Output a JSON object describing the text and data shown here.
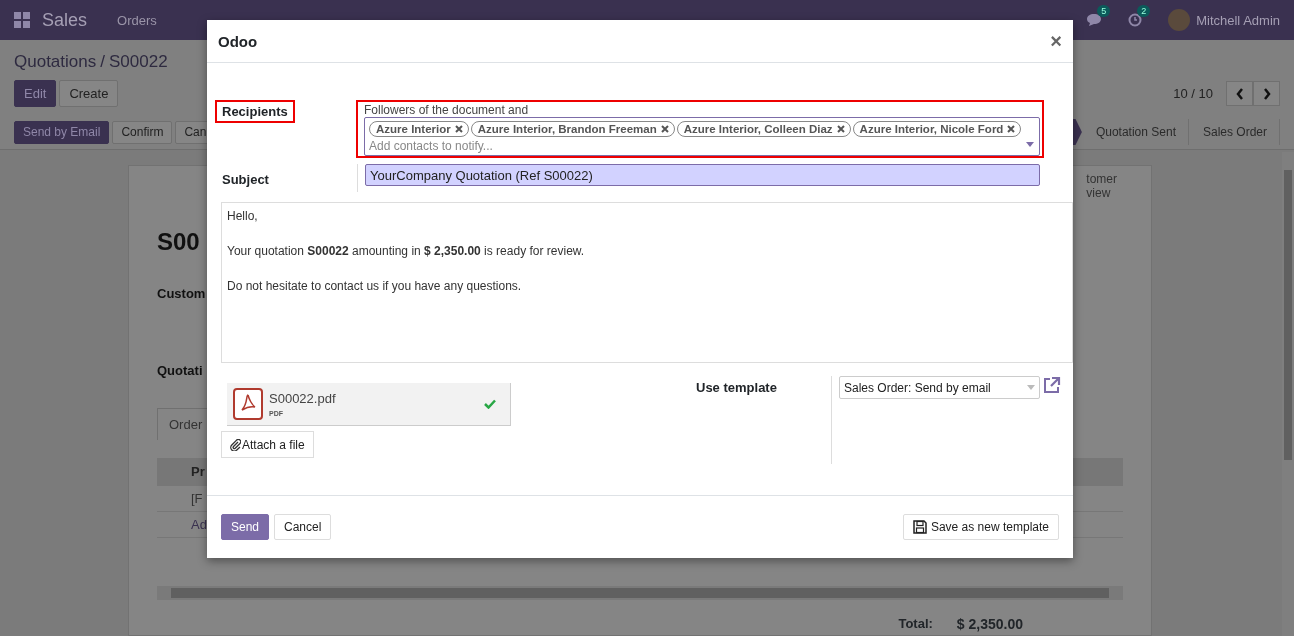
{
  "navbar": {
    "app": "Sales",
    "menu": [
      "Orders"
    ],
    "messages_badge": "5",
    "activities_badge": "2",
    "user": "Mitchell Admin"
  },
  "breadcrumb": {
    "parent": "Quotations",
    "separator": "/",
    "current": "S00022"
  },
  "actions": [
    "Edit",
    "Create"
  ],
  "pager": "10 / 10",
  "status_buttons": [
    {
      "label": "Send by Email",
      "primary": true
    },
    {
      "label": "Confirm",
      "primary": false
    },
    {
      "label": "Can",
      "primary": false
    }
  ],
  "stages": [
    "Quotation Sent",
    "Sales Order"
  ],
  "sheet": {
    "title": "S00",
    "field_labels": [
      "Custom",
      "Quotati"
    ],
    "smart_button": [
      "tomer",
      "view"
    ],
    "tab": "Order",
    "table_header": "Pr",
    "rows": [
      "[F",
      "Ad"
    ],
    "total_label": "Total:",
    "total_value": "$ 2,350.00"
  },
  "dialog": {
    "title": "Odoo",
    "close": "×",
    "recipients_label": "Recipients",
    "recipients_highlighted": true,
    "recipients_hint": "Followers of the document and",
    "recipients": [
      "Azure Interior",
      "Azure Interior, Brandon Freeman",
      "Azure Interior, Colleen Diaz",
      "Azure Interior, Nicole Ford"
    ],
    "contacts_placeholder": "Add contacts to notify...",
    "subject_label": "Subject",
    "subject": "YourCompany Quotation (Ref S00022)",
    "body": [
      "Hello,",
      "Your quotation **S00022** amounting in **$ 2,350.00** is ready for review.",
      "Do not hesitate to contact us if you have any questions."
    ],
    "attachment": {
      "name": "S00022.pdf",
      "type": "PDF",
      "uploaded": true
    },
    "attach_button": "Attach a file",
    "template_label": "Use template",
    "template": "Sales Order: Send by email",
    "buttons": {
      "send": "Send",
      "cancel": "Cancel",
      "save_template": "Save as new template"
    }
  }
}
